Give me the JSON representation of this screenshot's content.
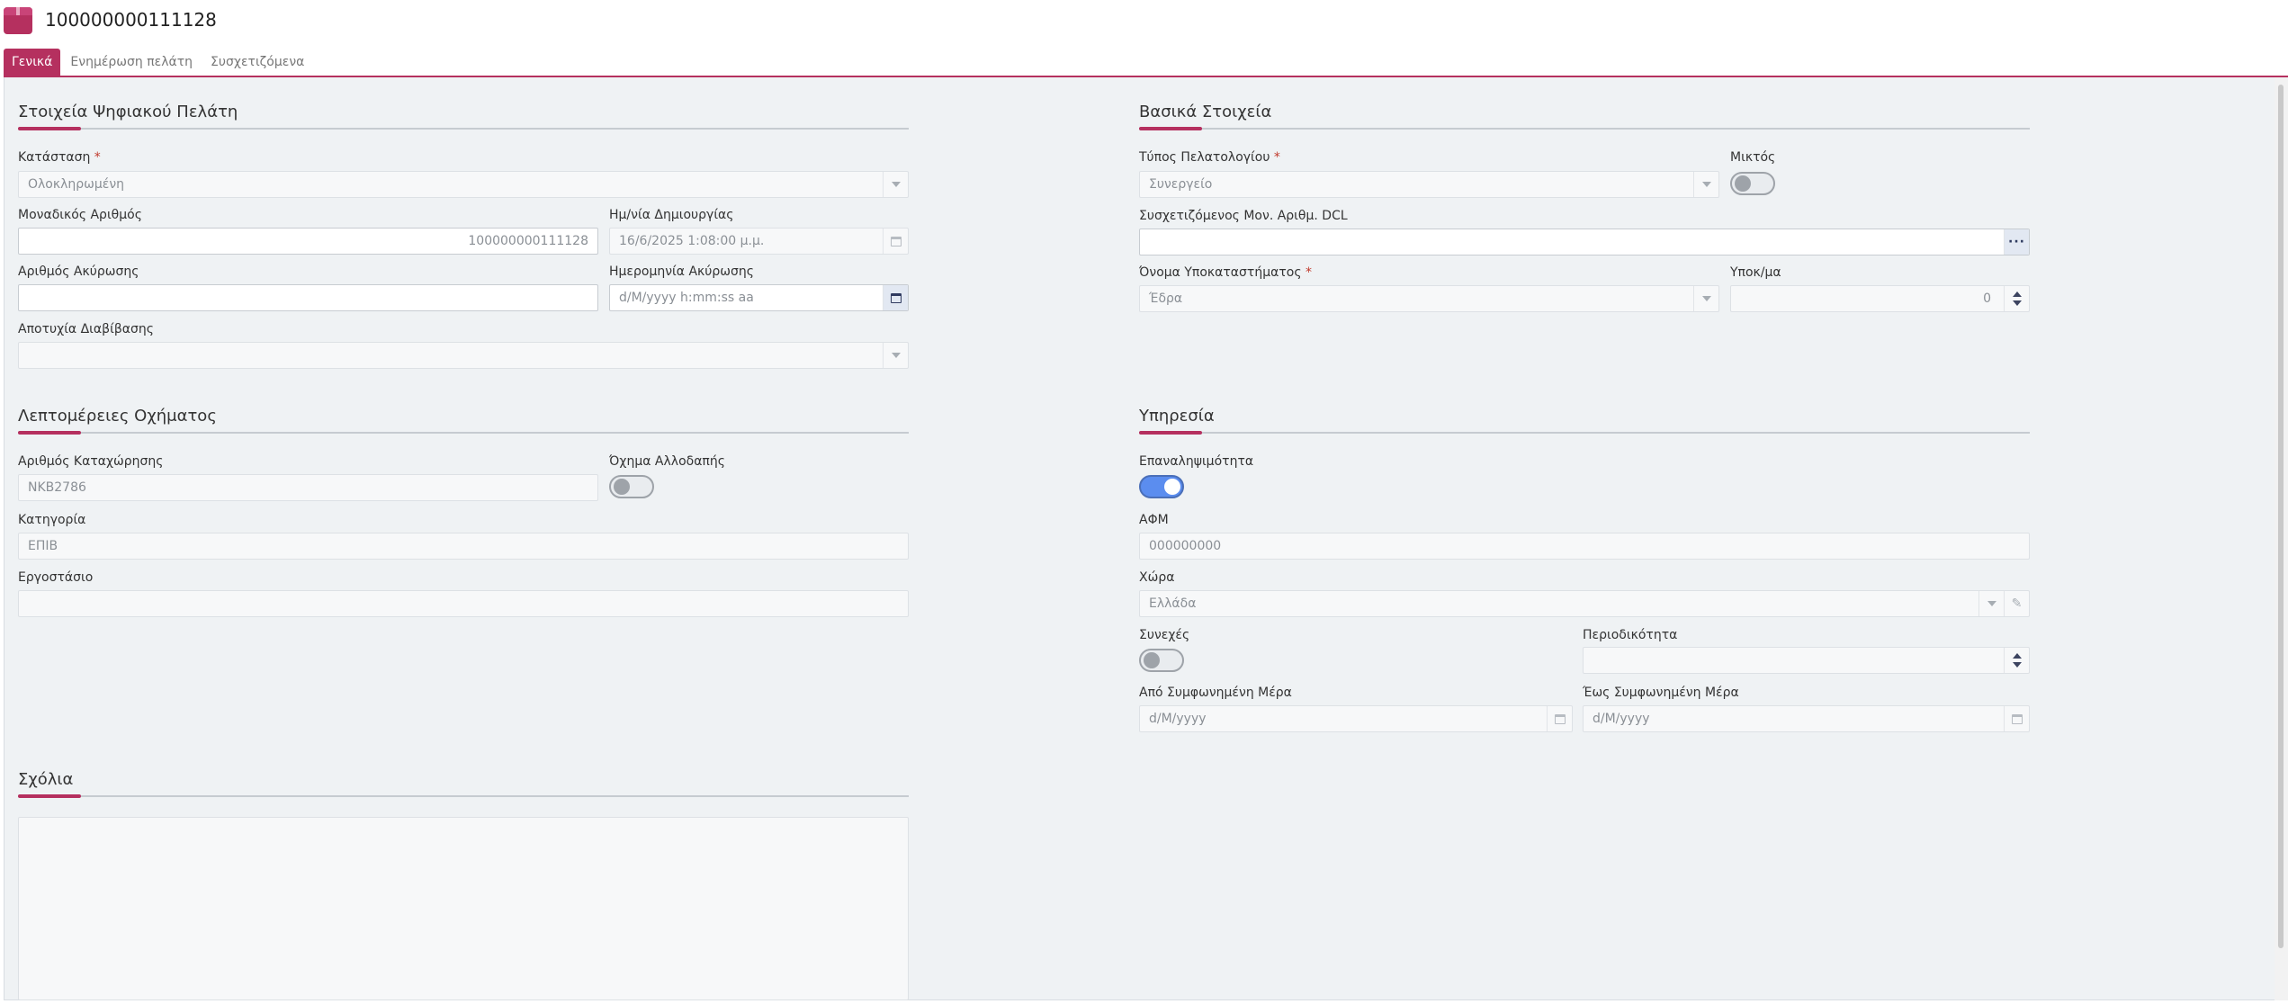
{
  "header": {
    "title": "100000000111128"
  },
  "tabs": [
    {
      "label": "Γενικά"
    },
    {
      "label": "Ενημέρωση πελάτη"
    },
    {
      "label": "Συσχετιζόμενα"
    }
  ],
  "digital_customer": {
    "title": "Στοιχεία Ψηφιακού Πελάτη",
    "status_label": "Κατάσταση",
    "status_value": "Ολοκληρωμένη",
    "unique_number_label": "Μοναδικός Αριθμός",
    "unique_number_value": "100000000111128",
    "created_label": "Ημ/νία Δημιουργίας",
    "created_value": "16/6/2025 1:08:00 μ.μ.",
    "cancel_number_label": "Αριθμός Ακύρωσης",
    "cancel_number_value": "",
    "cancel_date_label": "Ημερομηνία Ακύρωσης",
    "cancel_date_placeholder": "d/M/yyyy h:mm:ss aa",
    "transmission_failure_label": "Αποτυχία Διαβίβασης",
    "transmission_failure_value": ""
  },
  "basic": {
    "title": "Βασικά Στοιχεία",
    "client_type_label": "Τύπος Πελατολογίου",
    "client_type_value": "Συνεργείο",
    "mixed_label": "Μικτός",
    "mixed_on": false,
    "dcl_label": "Συσχετιζόμενος Μον. Αριθμ. DCL",
    "dcl_value": "",
    "branch_name_label": "Όνομα Υποκαταστήματος",
    "branch_name_value": "Έδρα",
    "branch_no_label": "Υποκ/μα",
    "branch_no_value": "0"
  },
  "vehicle": {
    "title": "Λεπτομέρειες Οχήματος",
    "reg_number_label": "Αριθμός Καταχώρησης",
    "reg_number_value": "ΝΚΒ2786",
    "foreign_label": "Όχημα Αλλοδαπής",
    "foreign_on": false,
    "category_label": "Κατηγορία",
    "category_value": "ΕΠΙΒ",
    "factory_label": "Εργοστάσιο",
    "factory_value": ""
  },
  "service": {
    "title": "Υπηρεσία",
    "repeatability_label": "Επαναληψιμότητα",
    "repeatability_on": true,
    "afm_label": "ΑΦΜ",
    "afm_value": "000000000",
    "country_label": "Χώρα",
    "country_value": "Ελλάδα",
    "continuous_label": "Συνεχές",
    "continuous_on": false,
    "periodicity_label": "Περιοδικότητα",
    "periodicity_value": "",
    "from_day_label": "Από Συμφωνημένη Μέρα",
    "from_day_placeholder": "d/M/yyyy",
    "to_day_label": "Έως Συμφωνημένη Μέρα",
    "to_day_placeholder": "d/M/yyyy"
  },
  "comments": {
    "title": "Σχόλια",
    "value": ""
  },
  "icons": {
    "app": "package-icon",
    "dropdown": "chevron-down-icon",
    "calendar": "calendar-icon",
    "lookup": "ellipsis-icon",
    "edit": "pencil-icon",
    "spinner": "spinner-arrows-icon"
  },
  "colors": {
    "accent": "#b5305f",
    "toggle_on": "#5b8def",
    "background": "#eff2f4"
  }
}
